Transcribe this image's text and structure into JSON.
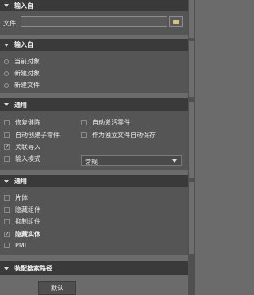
{
  "input_panel": {
    "header": "输入自",
    "file_label": "文件",
    "file_value": ""
  },
  "source_panel": {
    "header": "输入自",
    "options": [
      {
        "label": "当前对象",
        "selected": false
      },
      {
        "label": "新建对象",
        "selected": false
      },
      {
        "label": "新建文件",
        "selected": false
      }
    ]
  },
  "general_panel": {
    "header": "通用",
    "options": [
      {
        "label": "修复健陈",
        "checked": false
      },
      {
        "label": "自动激活零件",
        "checked": false
      },
      {
        "label": "自动创建子零件",
        "checked": false
      },
      {
        "label": "作为独立文件自动保存",
        "checked": false
      },
      {
        "label": "关联导入",
        "checked": true
      },
      {
        "label": "输入模式",
        "checked": false
      }
    ],
    "mode_select": "常规"
  },
  "general_panel2": {
    "header": "通用",
    "options": [
      {
        "label": "片体",
        "checked": false
      },
      {
        "label": "隐藏组件",
        "checked": false
      },
      {
        "label": "抑制组件",
        "checked": false
      },
      {
        "label": "隐藏实体",
        "checked": true
      },
      {
        "label": "PMI",
        "checked": false
      }
    ]
  },
  "assembly_panel": {
    "header": "装配搜索路径"
  },
  "default_button": "默认"
}
